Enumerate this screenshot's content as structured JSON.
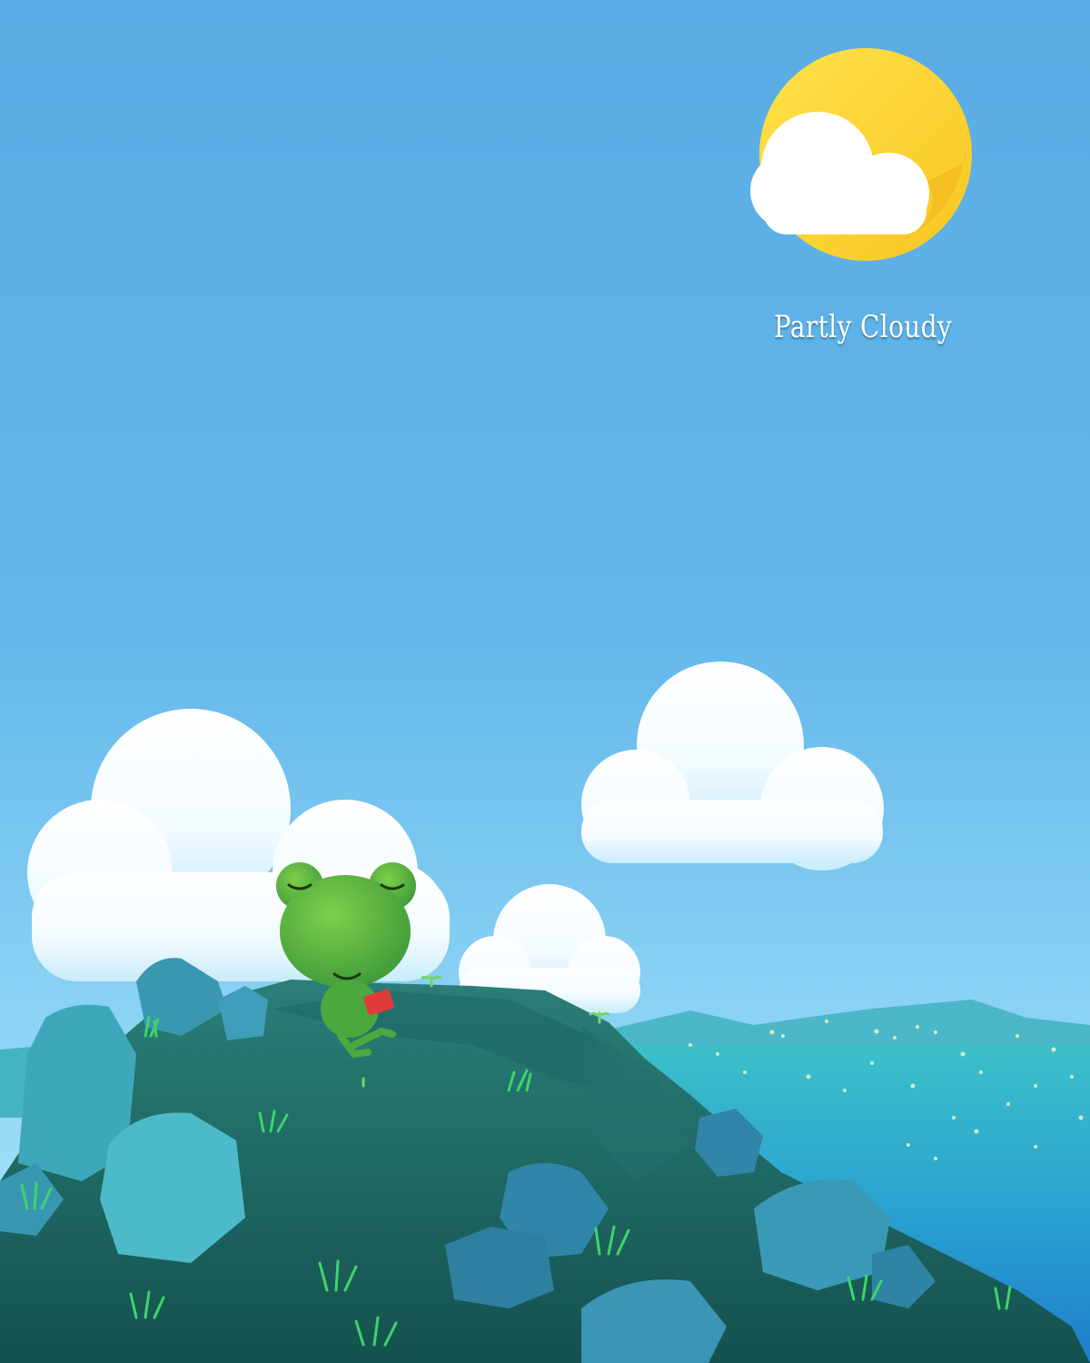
{
  "weather": {
    "condition": "Partly Cloudy",
    "icon": "partly-cloudy-icon",
    "sun_color": "#fdd835",
    "cloud_color": "#ffffff"
  },
  "scene": {
    "character": "frog-reading-book",
    "sky_top_color": "#5aade4",
    "sky_bottom_color": "#9ee0f5",
    "sea_color": "#2a9fd0",
    "rock_color": "#1f6f6f"
  }
}
